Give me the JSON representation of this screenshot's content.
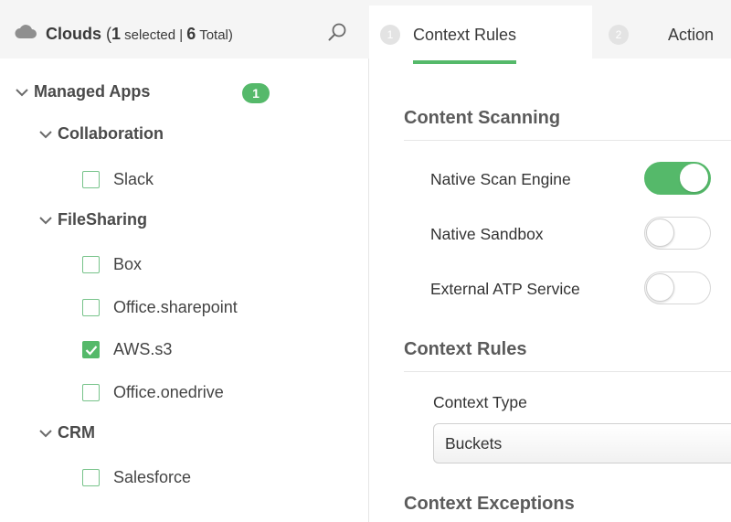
{
  "left_panel": {
    "header": {
      "title": "Clouds",
      "selected_open": " (",
      "selected_count": "1",
      "selected_text": " selected | ",
      "total_count": "6",
      "total_text": " Total)"
    },
    "managed_apps": {
      "label": "Managed Apps",
      "badge": "1"
    },
    "groups": [
      {
        "label": "Collaboration",
        "items": [
          {
            "label": "Slack",
            "checked": false
          }
        ]
      },
      {
        "label": "FileSharing",
        "items": [
          {
            "label": "Box",
            "checked": false
          },
          {
            "label": "Office.sharepoint",
            "checked": false
          },
          {
            "label": "AWS.s3",
            "checked": true
          },
          {
            "label": "Office.onedrive",
            "checked": false
          }
        ]
      },
      {
        "label": "CRM",
        "items": [
          {
            "label": "Salesforce",
            "checked": false
          }
        ]
      }
    ]
  },
  "tabs": [
    {
      "number": "1",
      "label": "Context Rules",
      "active": true
    },
    {
      "number": "2",
      "label": "Action",
      "active": false
    }
  ],
  "content": {
    "content_scanning": {
      "title": "Content Scanning",
      "options": [
        {
          "label": "Native Scan Engine",
          "enabled": true
        },
        {
          "label": "Native Sandbox",
          "enabled": false
        },
        {
          "label": "External ATP Service",
          "enabled": false
        }
      ]
    },
    "context_rules": {
      "title": "Context Rules",
      "field_label": "Context Type",
      "field_value": "Buckets"
    },
    "context_exceptions": {
      "title": "Context Exceptions"
    }
  },
  "colors": {
    "accent_green": "#55b96a",
    "header_gray": "#f5f5f5"
  }
}
